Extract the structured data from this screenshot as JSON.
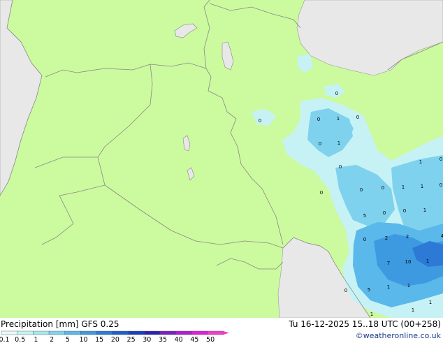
{
  "header": {
    "title": "Precipitation [mm]  GFS 0.25",
    "valid_time": "Tu 16-12-2025 15..18 UTC (00+258)",
    "credit": "©weatheronline.co.uk"
  },
  "legend": {
    "labels": [
      "0.1",
      "0.5",
      "1",
      "2",
      "5",
      "10",
      "15",
      "20",
      "25",
      "30",
      "35",
      "40",
      "45",
      "50"
    ],
    "colors": [
      "#e6fafa",
      "#c6f2f6",
      "#a4e6f2",
      "#7ed2ee",
      "#5ab8ea",
      "#3e9ae0",
      "#2c7ad6",
      "#1f5ecc",
      "#1a3ec0",
      "#2a22b0",
      "#7a20c6",
      "#b01ed0",
      "#e21ed8",
      "#f23ec8"
    ]
  },
  "map": {
    "land_color": "#ccfa9e",
    "sea_color": "#e8e8e8",
    "border_color": "#888888",
    "value_labels": [
      {
        "text": "0"
      },
      {
        "text": "0"
      },
      {
        "text": "1"
      },
      {
        "text": "0"
      },
      {
        "text": "0"
      },
      {
        "text": "0"
      },
      {
        "text": "1"
      },
      {
        "text": "0"
      },
      {
        "text": "1"
      },
      {
        "text": "0"
      },
      {
        "text": "0"
      },
      {
        "text": "0"
      },
      {
        "text": "0"
      },
      {
        "text": "1"
      },
      {
        "text": "1"
      },
      {
        "text": "0"
      },
      {
        "text": "0"
      },
      {
        "text": "1"
      },
      {
        "text": "5"
      },
      {
        "text": "2"
      },
      {
        "text": "0"
      },
      {
        "text": "0"
      },
      {
        "text": "2"
      },
      {
        "text": "7"
      },
      {
        "text": "10"
      },
      {
        "text": "1"
      },
      {
        "text": "0"
      },
      {
        "text": "5"
      },
      {
        "text": "1"
      },
      {
        "text": "1"
      },
      {
        "text": "1"
      },
      {
        "text": "1"
      },
      {
        "text": "1"
      },
      {
        "text": "4"
      }
    ]
  }
}
